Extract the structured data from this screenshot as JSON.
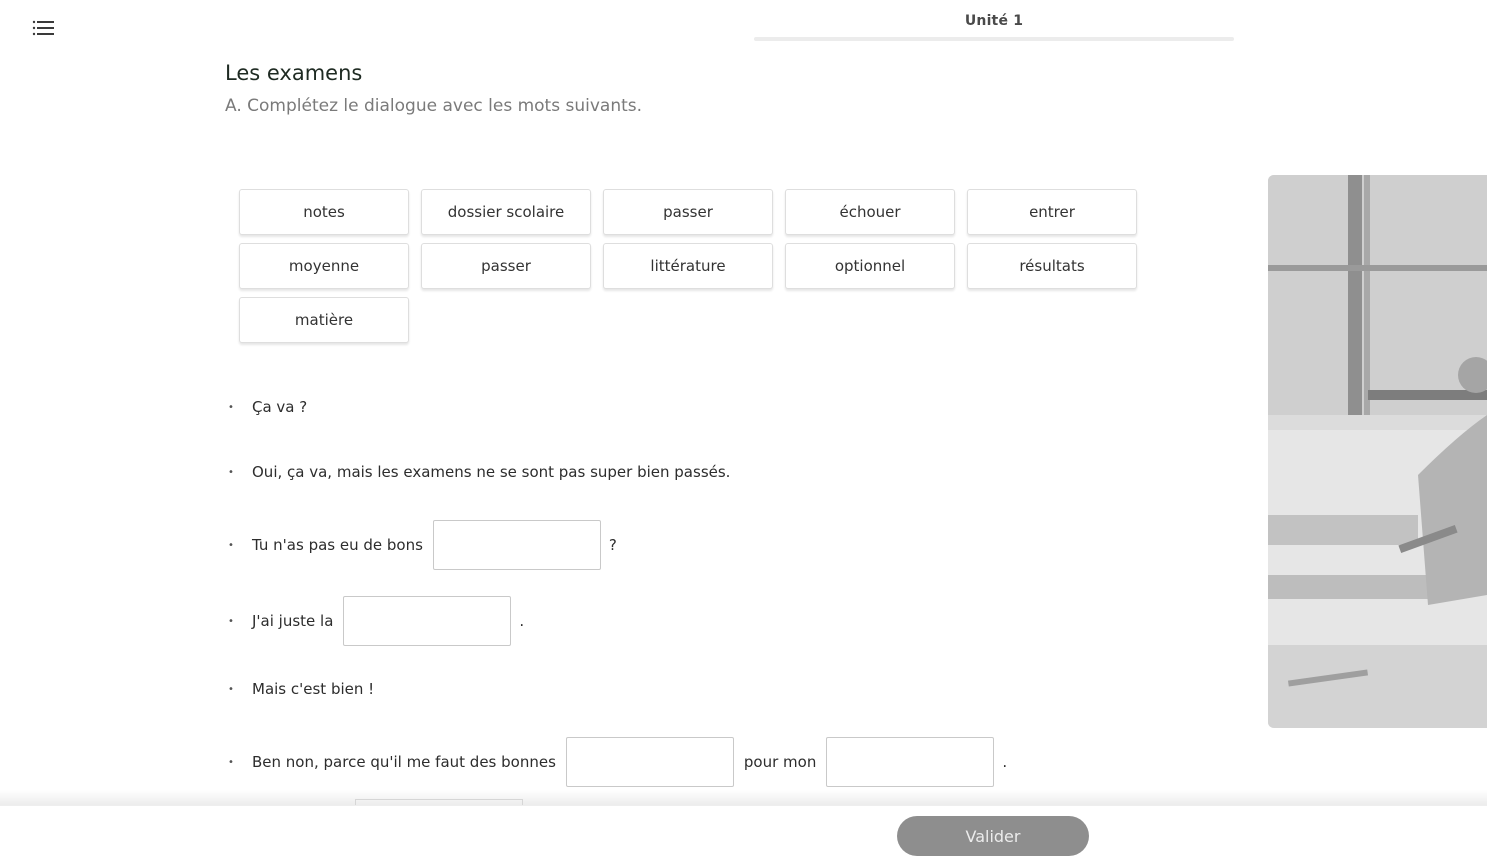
{
  "header": {
    "menu_icon": "hamburger-menu-icon",
    "unit_title": "Unité 1"
  },
  "exercise": {
    "title": "Les examens",
    "instruction": "A. Complétez le dialogue avec les mots suivants."
  },
  "word_bank": [
    "notes",
    "dossier scolaire",
    "passer",
    "échouer",
    "entrer",
    "moyenne",
    "passer",
    "littérature",
    "optionnel",
    "résultats",
    "matière"
  ],
  "dialogue": {
    "bullet": "•",
    "line1": "Ça va ?",
    "line2": "Oui, ça va, mais les examens ne se sont pas super bien passés.",
    "line3_before": "Tu n'as pas eu de bons",
    "line3_after": "?",
    "line4_before": "J'ai juste la",
    "line4_after": ".",
    "line5": "Mais c'est bien !",
    "line6_before": "Ben non, parce qu'il me faut des bonnes",
    "line6_middle": "pour mon",
    "line6_after": "."
  },
  "footer": {
    "validate_label": "Valider"
  }
}
